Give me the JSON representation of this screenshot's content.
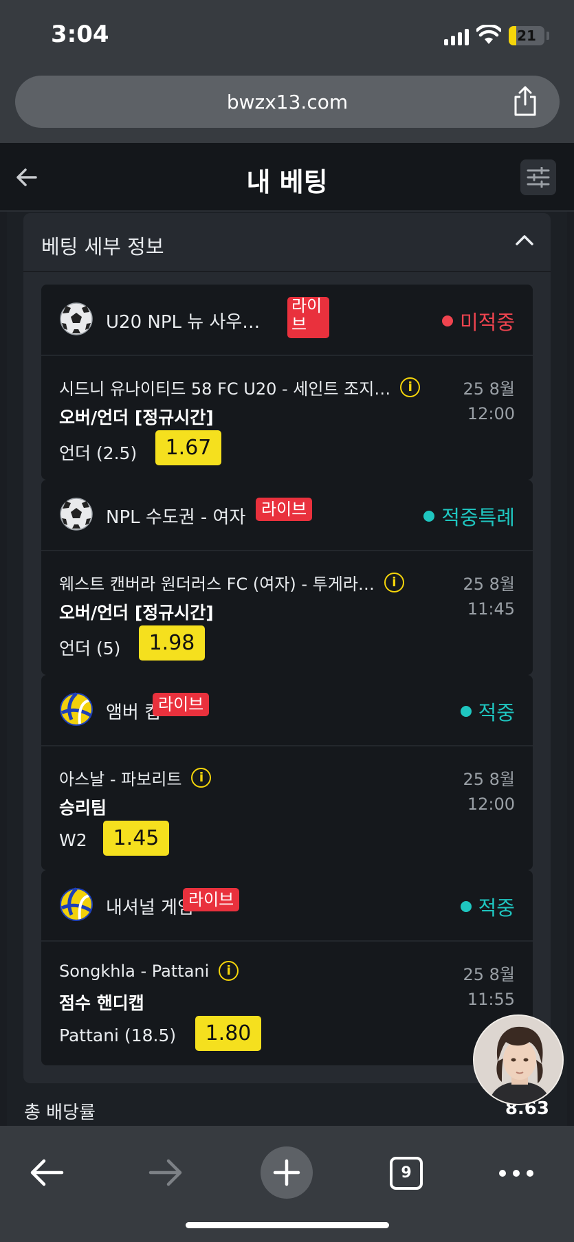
{
  "status": {
    "time": "3:04",
    "battery": "21",
    "battery_level": 0.21
  },
  "browser": {
    "url": "bwzx13.com",
    "tabs_count": "9"
  },
  "header": {
    "title": "내 베팅"
  },
  "panel": {
    "title": "베팅 세부 정보"
  },
  "bets": [
    {
      "sport": "soccer",
      "league": "U20 NPL 뉴 사우…",
      "live": "라이브",
      "live_line1": "라이",
      "live_line2": "브",
      "status": "미적중",
      "status_type": "lose",
      "match": "시드니 유나이티드 58 FC U20 - 세인트 조지…",
      "date": "25 8월",
      "time": "12:00",
      "market": "오버/언더 [정규시간]",
      "pick": "언더 (2.5)",
      "odds": "1.67"
    },
    {
      "sport": "soccer",
      "league": "NPL 수도권 - 여자",
      "live": "라이브",
      "status": "적중특례",
      "status_type": "win",
      "match": "웨스트 캔버라 원더러스 FC (여자) - 투게라…",
      "date": "25 8월",
      "time": "11:45",
      "market": "오버/언더 [정규시간]",
      "pick": "언더 (5)",
      "odds": "1.98"
    },
    {
      "sport": "volleyball",
      "league": "앰버 컵",
      "live": "라이브",
      "status": "적중",
      "status_type": "win",
      "match": "아스날 - 파보리트",
      "date": "25 8월",
      "time": "12:00",
      "market": "승리팀",
      "pick": "W2",
      "odds": "1.45"
    },
    {
      "sport": "volleyball",
      "league": "내셔널 게임",
      "live": "라이브",
      "status": "적중",
      "status_type": "win",
      "match": "Songkhla - Pattani",
      "date": "25 8월",
      "time": "11:55",
      "market": "점수 핸디캡",
      "pick": "Pattani (18.5)",
      "odds": "1.80"
    }
  ],
  "summary": {
    "total_label": "총 배당률",
    "total_value": "8.63"
  },
  "icons": {
    "back": "arrow-left-icon",
    "filter": "sliders-icon",
    "collapse": "chevron-up-icon",
    "share": "share-icon",
    "info": "info-icon",
    "soccer": "soccer-ball-icon",
    "volleyball": "volleyball-icon"
  },
  "colors": {
    "live": "#e9313d",
    "lose": "#f0444f",
    "win": "#1fc6c0",
    "odds": "#f5e01e"
  }
}
